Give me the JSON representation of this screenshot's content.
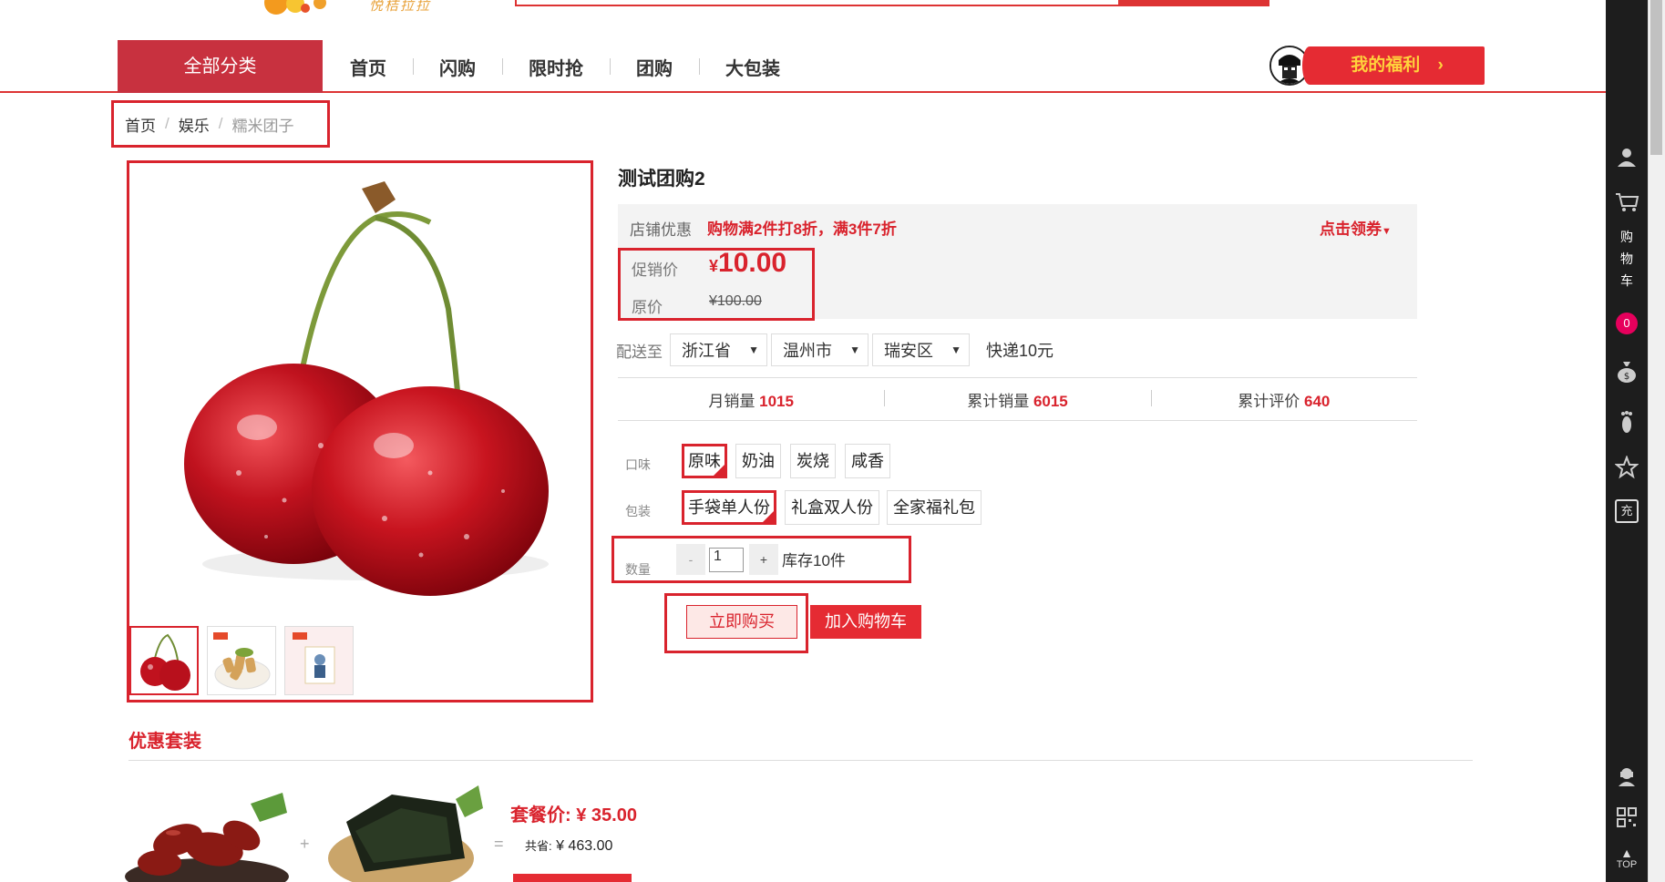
{
  "header": {
    "logo_text": "悦桔拉拉"
  },
  "nav": {
    "all_categories": "全部分类",
    "links": [
      "首页",
      "闪购",
      "限时抢",
      "团购",
      "大包装"
    ],
    "welfare_label": "我的福利",
    "welfare_arrow": "›"
  },
  "breadcrumb": {
    "items": [
      "首页",
      "娱乐",
      "糯米团子"
    ],
    "separator": "/"
  },
  "product": {
    "title": "测试团购2",
    "promo_label": "店铺优惠",
    "promo_text": "购物满2件打8折，满3件7折",
    "coupon_link": "点击领券",
    "sale_label": "促销价",
    "currency": "¥",
    "sale_price": "10.00",
    "original_label": "原价",
    "original_price": "¥100.00",
    "ship_label": "配送至",
    "province": "浙江省",
    "city": "温州市",
    "district": "瑞安区",
    "shipping_fee": "快递10元",
    "stats": {
      "monthly_label": "月销量",
      "monthly_value": "1015",
      "total_label": "累计销量",
      "total_value": "6015",
      "review_label": "累计评价",
      "review_value": "640"
    },
    "flavor_label": "口味",
    "flavors": [
      "原味",
      "奶油",
      "炭烧",
      "咸香"
    ],
    "package_label": "包装",
    "packages": [
      "手袋单人份",
      "礼盒双人份",
      "全家福礼包"
    ],
    "qty_label": "数量",
    "qty_minus": "-",
    "qty_value": "1",
    "qty_plus": "+",
    "stock": "库存10件",
    "buy_now": "立即购买",
    "add_cart": "加入购物车"
  },
  "combo": {
    "title": "优惠套装",
    "plus": "+",
    "equals": "=",
    "price": "套餐价: ¥ 35.00",
    "save_label": "共省:",
    "save_value": "¥ 463.00"
  },
  "sidebar": {
    "cart_chars": [
      "购",
      "物",
      "车"
    ],
    "cart_count": "0",
    "charge": "充",
    "top": "TOP"
  },
  "colors": {
    "brand_red": "#d9232d",
    "nav_red": "#c8313f",
    "sidebar_bg": "#1d1d1d"
  }
}
